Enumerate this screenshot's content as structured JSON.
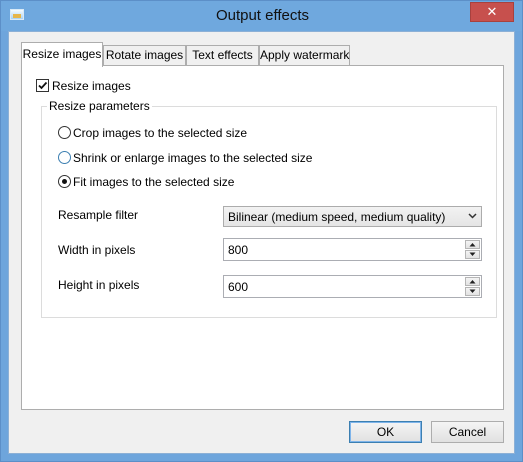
{
  "window": {
    "title": "Output effects",
    "close_glyph": "✕"
  },
  "tabs": [
    {
      "label": "Resize images",
      "active": true
    },
    {
      "label": "Rotate images",
      "active": false
    },
    {
      "label": "Text effects",
      "active": false
    },
    {
      "label": "Apply watermark",
      "active": false
    }
  ],
  "resize": {
    "enable_label": "Resize images",
    "enabled": true,
    "group_title": "Resize parameters",
    "options": [
      {
        "label": "Crop images to the selected size",
        "selected": false
      },
      {
        "label": "Shrink or enlarge images to the selected size",
        "selected": false
      },
      {
        "label": "Fit images to the selected size",
        "selected": true
      }
    ],
    "filter_label": "Resample filter",
    "filter_value": "Bilinear (medium speed, medium quality)",
    "width_label": "Width in pixels",
    "width_value": "800",
    "height_label": "Height in pixels",
    "height_value": "600"
  },
  "buttons": {
    "ok": "OK",
    "cancel": "Cancel"
  },
  "icons": {
    "app": "image-icon",
    "close": "close-icon",
    "check": "check-icon",
    "dropdown": "chevron-down-icon",
    "spin_up": "spin-up-icon",
    "spin_down": "spin-down-icon"
  }
}
